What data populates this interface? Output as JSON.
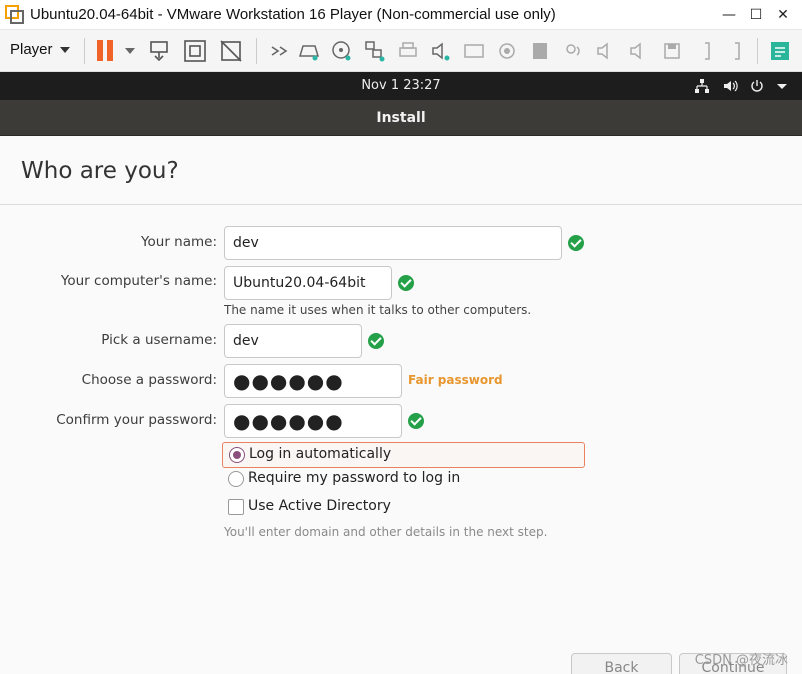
{
  "window": {
    "title": "Ubuntu20.04-64bit - VMware Workstation 16 Player (Non-commercial use only)",
    "minimize_glyph": "—",
    "maximize_glyph": "☐",
    "close_glyph": "✕"
  },
  "vmware_toolbar": {
    "player_label": "Player",
    "icons": [
      "pause-icon",
      "send-ctrl-alt-del-icon",
      "fit-guest-icon",
      "unity-icon",
      "forward-icon",
      "hard-disk-icon",
      "cd-dvd-icon",
      "network-adapter-icon",
      "printer-icon",
      "sound-card-icon",
      "camera-icon",
      "usb-icon",
      "hdd-device-icon",
      "microphone-icon",
      "speaker-icon",
      "speaker-icon",
      "floppy-icon",
      "bracket-icon",
      "bracket-icon",
      "notes-icon"
    ],
    "accent_color": "#f0642a"
  },
  "gnome_panel": {
    "clock": "Nov 1  23:27"
  },
  "installer": {
    "header_title": "Install",
    "page_title": "Who are you?",
    "your_name": {
      "label": "Your name:",
      "value": "dev"
    },
    "computer_name": {
      "label": "Your computer's name:",
      "value": "Ubuntu20.04-64bit",
      "hint": "The name it uses when it talks to other computers."
    },
    "username": {
      "label": "Pick a username:",
      "value": "dev"
    },
    "password": {
      "label": "Choose a password:",
      "value": "●●●●●●",
      "strength": "Fair password"
    },
    "confirm_password": {
      "label": "Confirm your password:",
      "value": "●●●●●●"
    },
    "login_options": [
      {
        "label": "Log in automatically",
        "selected": true
      },
      {
        "label": "Require my password to log in",
        "selected": false
      }
    ],
    "active_directory": {
      "label": "Use Active Directory",
      "checked": false,
      "hint": "You'll enter domain and other details in the next step."
    },
    "buttons": {
      "back": "Back",
      "continue": "Continue"
    }
  },
  "watermark": "CSDN @夜流冰",
  "colors": {
    "check_green": "#24a148",
    "fair_orange": "#e8962e",
    "radio_purple": "#8a4f7d",
    "focus_border": "#e9835f"
  }
}
